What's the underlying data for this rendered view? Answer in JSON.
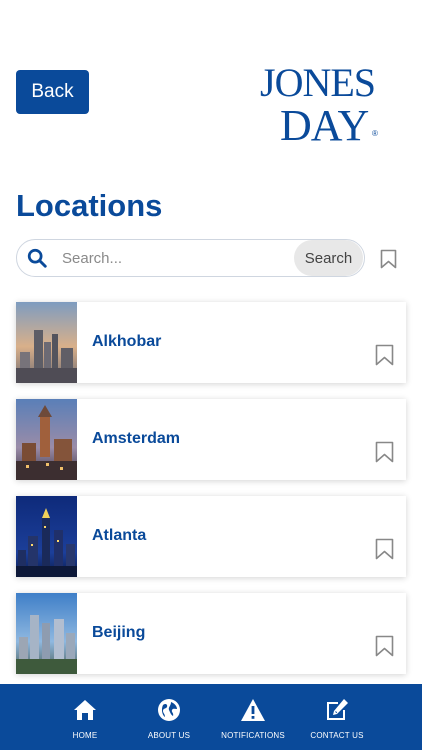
{
  "header": {
    "back_label": "Back",
    "logo_text_line1": "JONES",
    "logo_text_line2": "DAY",
    "logo_mark": "®"
  },
  "page_title": "Locations",
  "search": {
    "placeholder": "Search...",
    "button_label": "Search",
    "bookmark_icon": "bookmark-outline-icon"
  },
  "locations": [
    {
      "name": "Alkhobar",
      "thumb_icon": "city-photo"
    },
    {
      "name": "Amsterdam",
      "thumb_icon": "city-photo"
    },
    {
      "name": "Atlanta",
      "thumb_icon": "city-photo"
    },
    {
      "name": "Beijing",
      "thumb_icon": "city-photo"
    }
  ],
  "tabbar": {
    "items": [
      {
        "label": "HOME",
        "icon": "home-icon"
      },
      {
        "label": "ABOUT US",
        "icon": "globe-icon"
      },
      {
        "label": "NOTIFICATIONS",
        "icon": "warning-icon"
      },
      {
        "label": "CONTACT US",
        "icon": "edit-icon"
      }
    ]
  },
  "colors": {
    "brand_blue": "#0a4a9a",
    "search_button_bg": "#e8e8e8",
    "bookmark_gray": "#888888"
  }
}
